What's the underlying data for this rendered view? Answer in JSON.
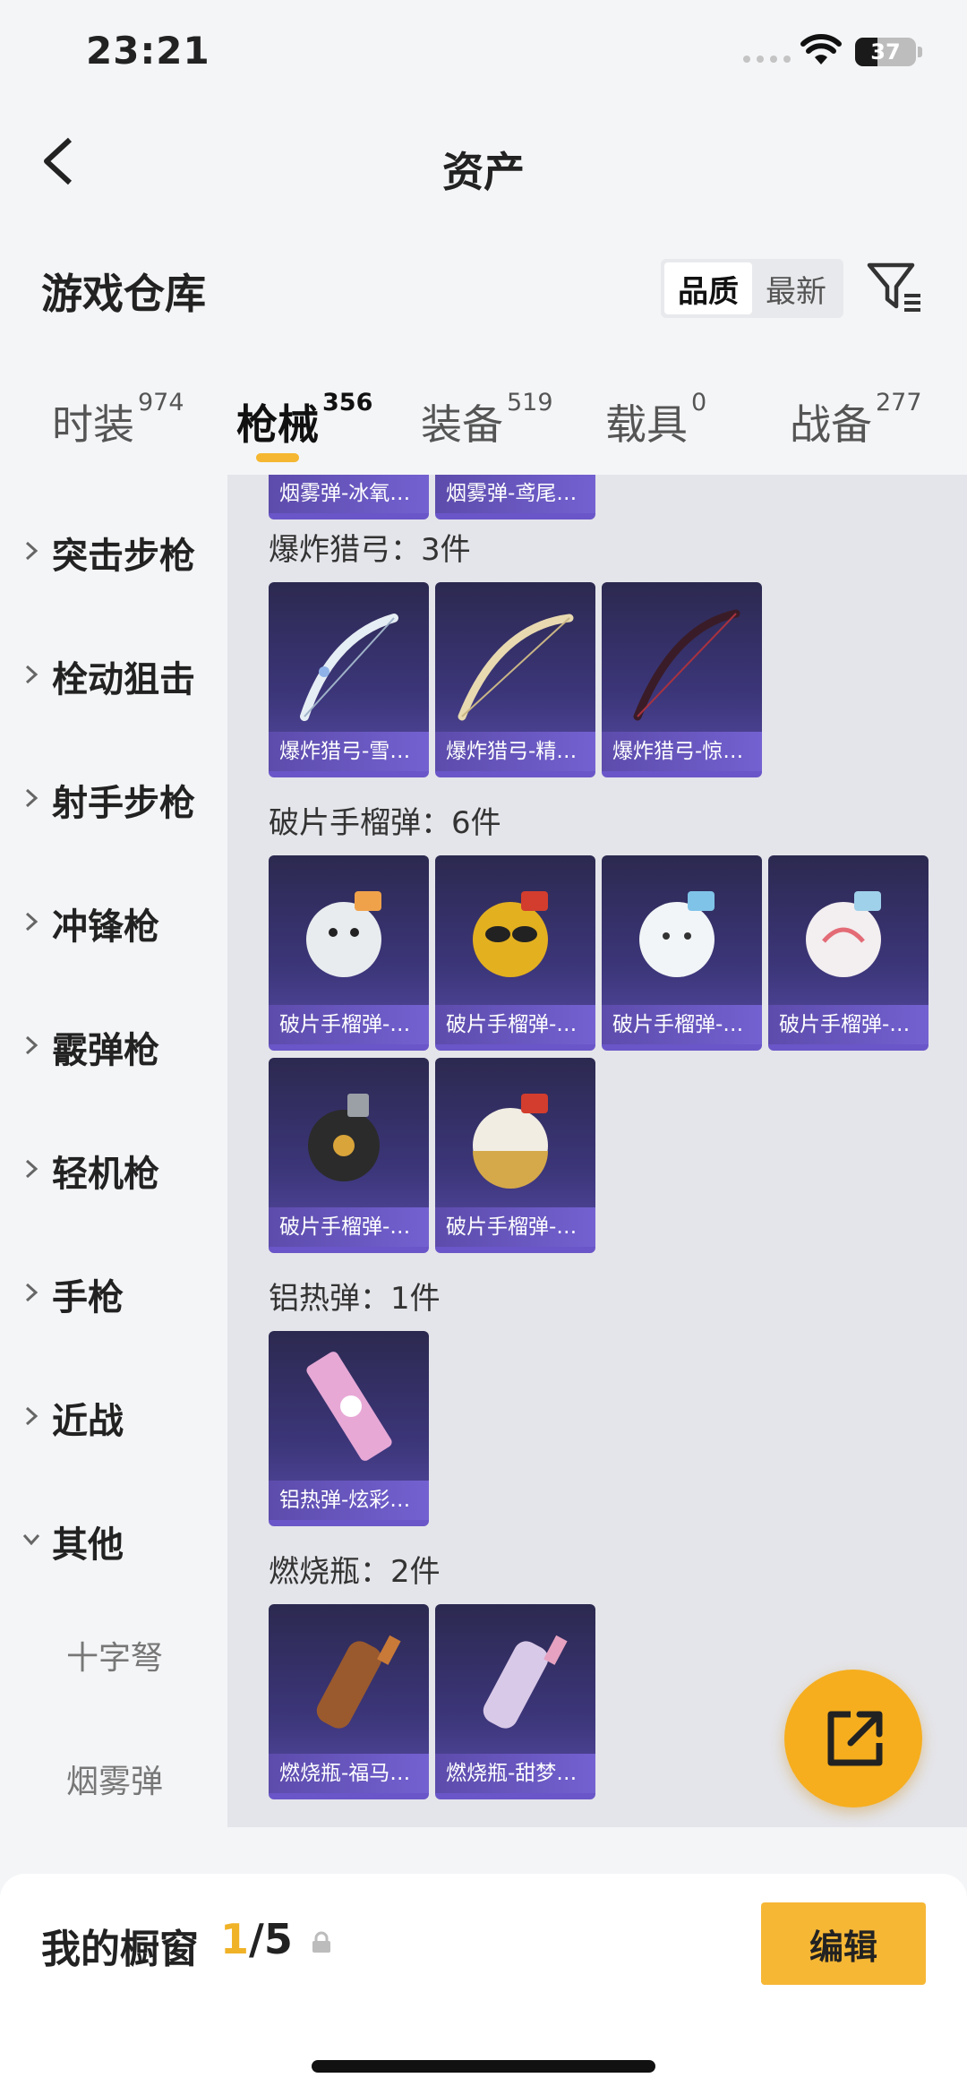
{
  "status": {
    "time": "23:21",
    "battery": "37",
    "battery_level": 0.37
  },
  "nav": {
    "title": "资产"
  },
  "warehouse": {
    "title": "游戏仓库",
    "sort_options": [
      "品质",
      "最新"
    ]
  },
  "tabs": [
    {
      "label": "时装",
      "count": "974"
    },
    {
      "label": "枪械",
      "count": "356"
    },
    {
      "label": "装备",
      "count": "519"
    },
    {
      "label": "载具",
      "count": "0"
    },
    {
      "label": "战备",
      "count": "277"
    }
  ],
  "sidebar": {
    "categories": [
      "突击步枪",
      "栓动狙击",
      "射手步枪",
      "冲锋枪",
      "霰弹枪",
      "轻机枪",
      "手枪",
      "近战",
      "其他"
    ],
    "subitems": [
      "十字弩",
      "烟雾弹"
    ]
  },
  "groups": [
    {
      "title": "",
      "items": [
        "烟雾弹-冰氧…",
        "烟雾弹-鸢尾…"
      ]
    },
    {
      "title": "爆炸猎弓：3件",
      "items": [
        "爆炸猎弓-雪…",
        "爆炸猎弓-精…",
        "爆炸猎弓-惊…"
      ]
    },
    {
      "title": "破片手榴弹：6件",
      "items": [
        "破片手榴弹-…",
        "破片手榴弹-…",
        "破片手榴弹-…",
        "破片手榴弹-…",
        "破片手榴弹-…",
        "破片手榴弹-…"
      ]
    },
    {
      "title": "铝热弹：1件",
      "items": [
        "铝热弹-炫彩…"
      ]
    },
    {
      "title": "燃烧瓶：2件",
      "items": [
        "燃烧瓶-福马…",
        "燃烧瓶-甜梦…"
      ]
    }
  ],
  "showcase": {
    "title": "我的橱窗",
    "current": "1",
    "total": "/5",
    "edit_label": "编辑"
  },
  "colors": {
    "accent": "#f5b731",
    "card_bg": "#3c367a",
    "card_caption": "#6a56c8"
  },
  "icons": {
    "back": "chevron-left-icon",
    "filter": "filter-icon",
    "share": "share-external-icon",
    "lock": "lock-icon"
  }
}
